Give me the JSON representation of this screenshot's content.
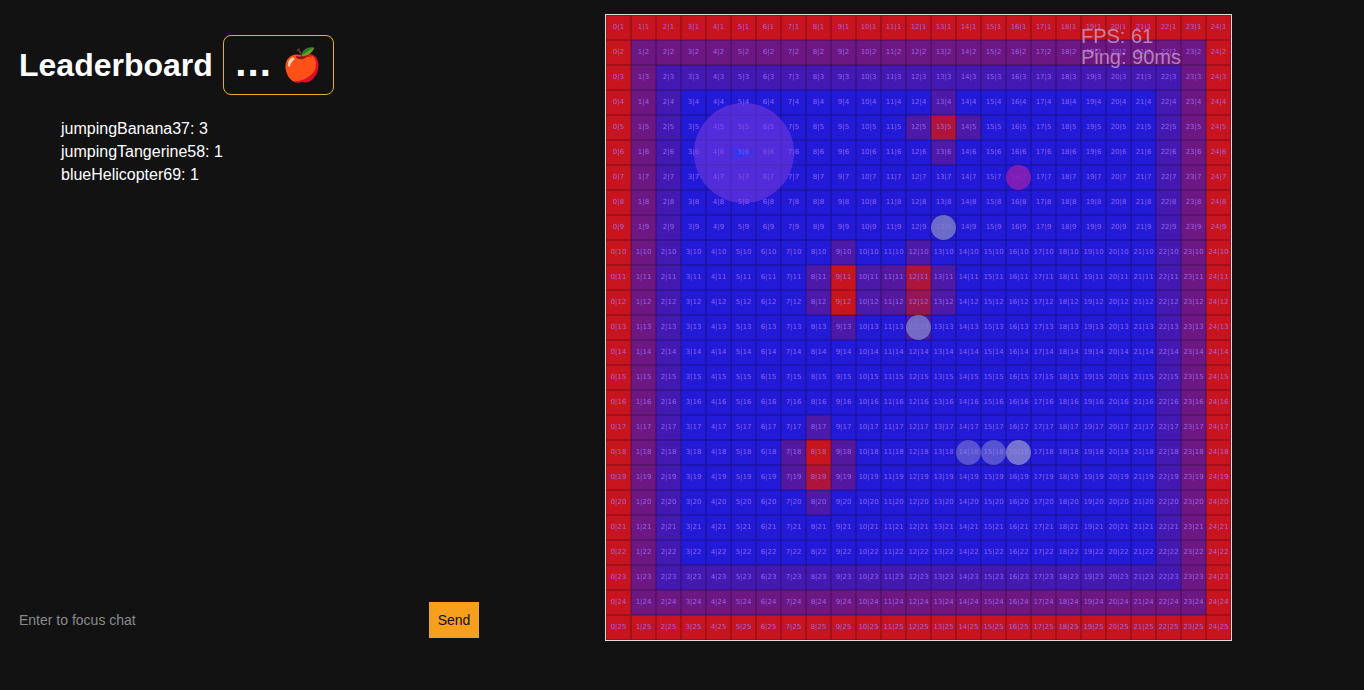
{
  "leaderboard": {
    "title": "Leaderboard",
    "badge": "... 🍎",
    "entries": [
      "jumpingBanana37: 3",
      "jumpingTangerine58: 1",
      "blueHelicopter69: 1"
    ]
  },
  "hud": {
    "fps": "FPS: 61",
    "ping": "Ping: 90ms"
  },
  "chat": {
    "placeholder": "Enter to focus chat",
    "button": "Send"
  },
  "arena": {
    "labels": [
      [
        "0|1",
        "1|1",
        "2|1",
        "3|1",
        "4|1",
        "5|1",
        "6|1",
        "7|1",
        "8|1",
        "9|1",
        "10|1",
        "11|1",
        "12|1",
        "13|1",
        "14|1",
        "15|1",
        "16|1",
        "17|1",
        "18|1",
        "19|1",
        "20|1",
        "21|1",
        "22|1",
        "23|1",
        "24|1"
      ],
      [
        "0|2",
        "1|2",
        "2|2",
        "3|2",
        "4|2",
        "5|2",
        "6|2",
        "7|2",
        "8|2",
        "9|2",
        "10|2",
        "11|2",
        "12|2",
        "13|2",
        "14|2",
        "15|2",
        "16|2",
        "17|2",
        "18|2",
        "19|2",
        "20|2",
        "21|2",
        "22|2",
        "23|2",
        "24|2"
      ],
      [
        "0|3",
        "1|3",
        "2|3",
        "3|3",
        "4|3",
        "5|3",
        "6|3",
        "7|3",
        "8|3",
        "9|3",
        "10|3",
        "11|3",
        "12|3",
        "13|3",
        "14|3",
        "15|3",
        "16|3",
        "17|3",
        "18|3",
        "19|3",
        "20|3",
        "21|3",
        "22|3",
        "23|3",
        "24|3"
      ],
      [
        "0|4",
        "1|4",
        "2|4",
        "3|4",
        "4|4",
        "5|4",
        "6|4",
        "7|4",
        "8|4",
        "9|4",
        "10|4",
        "11|4",
        "12|4",
        "13|4",
        "14|4",
        "15|4",
        "16|4",
        "17|4",
        "18|4",
        "19|4",
        "20|4",
        "21|4",
        "22|4",
        "23|4",
        "24|4"
      ],
      [
        "0|5",
        "1|5",
        "2|5",
        "3|5",
        "4|5",
        "5|5",
        "6|5",
        "7|5",
        "8|5",
        "9|5",
        "10|5",
        "11|5",
        "12|5",
        "13|5",
        "14|5",
        "15|5",
        "16|5",
        "17|5",
        "18|5",
        "19|5",
        "20|5",
        "21|5",
        "22|5",
        "23|5",
        "24|5"
      ],
      [
        "0|6",
        "1|6",
        "2|6",
        "3|6",
        "4|6",
        "5|6",
        "6|6",
        "7|6",
        "8|6",
        "9|6",
        "10|6",
        "11|6",
        "12|6",
        "13|6",
        "14|6",
        "15|6",
        "16|6",
        "17|6",
        "18|6",
        "19|6",
        "20|6",
        "21|6",
        "22|6",
        "23|6",
        "24|6"
      ],
      [
        "0|7",
        "1|7",
        "2|7",
        "3|7",
        "4|7",
        "5|7",
        "6|7",
        "7|7",
        "8|7",
        "9|7",
        "10|7",
        "11|7",
        "12|7",
        "13|7",
        "14|7",
        "15|7",
        "16|7",
        "17|7",
        "18|7",
        "19|7",
        "20|7",
        "21|7",
        "22|7",
        "23|7",
        "24|7"
      ],
      [
        "0|8",
        "1|8",
        "2|8",
        "3|8",
        "4|8",
        "5|8",
        "6|8",
        "7|8",
        "8|8",
        "9|8",
        "10|8",
        "11|8",
        "12|8",
        "13|8",
        "14|8",
        "15|8",
        "16|8",
        "17|8",
        "18|8",
        "19|8",
        "20|8",
        "21|8",
        "22|8",
        "23|8",
        "24|8"
      ],
      [
        "0|9",
        "1|9",
        "2|9",
        "3|9",
        "4|9",
        "5|9",
        "6|9",
        "7|9",
        "8|9",
        "9|9",
        "10|9",
        "11|9",
        "12|9",
        "13|9",
        "14|9",
        "15|9",
        "16|9",
        "17|9",
        "18|9",
        "19|9",
        "20|9",
        "21|9",
        "22|9",
        "23|9",
        "24|9"
      ],
      [
        "0|10",
        "1|10",
        "2|10",
        "3|10",
        "4|10",
        "5|10",
        "6|10",
        "7|10",
        "8|10",
        "9|10",
        "10|10",
        "11|10",
        "12|10",
        "13|10",
        "14|10",
        "15|10",
        "16|10",
        "17|10",
        "18|10",
        "19|10",
        "20|10",
        "21|10",
        "22|10",
        "23|10",
        "24|10"
      ],
      [
        "0|11",
        "1|11",
        "2|11",
        "3|11",
        "4|11",
        "5|11",
        "6|11",
        "7|11",
        "8|11",
        "9|11",
        "10|11",
        "11|11",
        "12|11",
        "13|11",
        "14|11",
        "15|11",
        "16|11",
        "17|11",
        "18|11",
        "19|11",
        "20|11",
        "21|11",
        "22|11",
        "23|11",
        "24|11"
      ],
      [
        "0|12",
        "1|12",
        "2|12",
        "3|12",
        "4|12",
        "5|12",
        "6|12",
        "7|12",
        "8|12",
        "9|12",
        "10|12",
        "11|12",
        "12|12",
        "13|12",
        "14|12",
        "15|12",
        "16|12",
        "17|12",
        "18|12",
        "19|12",
        "20|12",
        "21|12",
        "22|12",
        "23|12",
        "24|12"
      ],
      [
        "0|13",
        "1|13",
        "2|13",
        "3|13",
        "4|13",
        "5|13",
        "6|13",
        "7|13",
        "8|13",
        "9|13",
        "10|13",
        "11|13",
        "12|13",
        "13|13",
        "14|13",
        "15|13",
        "16|13",
        "17|13",
        "18|13",
        "19|13",
        "20|13",
        "21|13",
        "22|13",
        "23|13",
        "24|13"
      ],
      [
        "0|14",
        "1|14",
        "2|14",
        "3|14",
        "4|14",
        "5|14",
        "6|14",
        "7|14",
        "8|14",
        "9|14",
        "10|14",
        "11|14",
        "12|14",
        "13|14",
        "14|14",
        "15|14",
        "16|14",
        "17|14",
        "18|14",
        "19|14",
        "20|14",
        "21|14",
        "22|14",
        "23|14",
        "24|14"
      ],
      [
        "0|15",
        "1|15",
        "2|15",
        "3|15",
        "4|15",
        "5|15",
        "6|15",
        "7|15",
        "8|15",
        "9|15",
        "10|15",
        "11|15",
        "12|15",
        "13|15",
        "14|15",
        "15|15",
        "16|15",
        "17|15",
        "18|15",
        "19|15",
        "20|15",
        "21|15",
        "22|15",
        "23|15",
        "24|15"
      ],
      [
        "0|16",
        "1|16",
        "2|16",
        "3|16",
        "4|16",
        "5|16",
        "6|16",
        "7|16",
        "8|16",
        "9|16",
        "10|16",
        "11|16",
        "12|16",
        "13|16",
        "14|16",
        "15|16",
        "16|16",
        "17|16",
        "18|16",
        "19|16",
        "20|16",
        "21|16",
        "22|16",
        "23|16",
        "24|16"
      ],
      [
        "0|17",
        "1|17",
        "2|17",
        "3|17",
        "4|17",
        "5|17",
        "6|17",
        "7|17",
        "8|17",
        "9|17",
        "10|17",
        "11|17",
        "12|17",
        "13|17",
        "14|17",
        "15|17",
        "16|17",
        "17|17",
        "18|17",
        "19|17",
        "20|17",
        "21|17",
        "22|17",
        "23|17",
        "24|17"
      ],
      [
        "0|18",
        "1|18",
        "2|18",
        "3|18",
        "4|18",
        "5|18",
        "6|18",
        "7|18",
        "8|18",
        "9|18",
        "10|18",
        "11|18",
        "12|18",
        "13|18",
        "14|18",
        "15|18",
        "16|18",
        "17|18",
        "18|18",
        "19|18",
        "20|18",
        "21|18",
        "22|18",
        "23|18",
        "24|18"
      ],
      [
        "0|19",
        "1|19",
        "2|19",
        "3|19",
        "4|19",
        "5|19",
        "6|19",
        "7|19",
        "8|19",
        "9|19",
        "10|19",
        "11|19",
        "12|19",
        "13|19",
        "14|19",
        "15|19",
        "16|19",
        "17|19",
        "18|19",
        "19|19",
        "20|19",
        "21|19",
        "22|19",
        "23|19",
        "24|19"
      ],
      [
        "0|20",
        "1|20",
        "2|20",
        "3|20",
        "4|20",
        "5|20",
        "6|20",
        "7|20",
        "8|20",
        "9|20",
        "10|20",
        "11|20",
        "12|20",
        "13|20",
        "14|20",
        "15|20",
        "16|20",
        "17|20",
        "18|20",
        "19|20",
        "20|20",
        "21|20",
        "22|20",
        "23|20",
        "24|20"
      ],
      [
        "0|21",
        "1|21",
        "2|21",
        "3|21",
        "4|21",
        "5|21",
        "6|21",
        "7|21",
        "8|21",
        "9|21",
        "10|21",
        "11|21",
        "12|21",
        "13|21",
        "14|21",
        "15|21",
        "16|21",
        "17|21",
        "18|21",
        "19|21",
        "20|21",
        "21|21",
        "22|21",
        "23|21",
        "24|21"
      ],
      [
        "0|22",
        "1|22",
        "2|22",
        "3|22",
        "4|22",
        "5|22",
        "6|22",
        "7|22",
        "8|22",
        "9|22",
        "10|22",
        "11|22",
        "12|22",
        "13|22",
        "14|22",
        "15|22",
        "16|22",
        "17|22",
        "18|22",
        "19|22",
        "20|22",
        "21|22",
        "22|22",
        "23|22",
        "24|22"
      ],
      [
        "0|23",
        "1|23",
        "2|23",
        "3|23",
        "4|23",
        "5|23",
        "6|23",
        "7|23",
        "8|23",
        "9|23",
        "10|23",
        "11|23",
        "12|23",
        "13|23",
        "14|23",
        "15|23",
        "16|23",
        "17|23",
        "18|23",
        "19|23",
        "20|23",
        "21|23",
        "22|23",
        "23|23",
        "24|23"
      ],
      [
        "0|24",
        "1|24",
        "2|24",
        "3|24",
        "4|24",
        "5|24",
        "6|24",
        "7|24",
        "8|24",
        "9|24",
        "10|24",
        "11|24",
        "12|24",
        "13|24",
        "14|24",
        "15|24",
        "16|24",
        "17|24",
        "18|24",
        "19|24",
        "20|24",
        "21|24",
        "22|24",
        "23|24",
        "24|24"
      ],
      [
        "0|25",
        "1|25",
        "2|25",
        "3|25",
        "4|25",
        "5|25",
        "6|25",
        "7|25",
        "8|25",
        "9|25",
        "10|25",
        "11|25",
        "12|25",
        "13|25",
        "14|25",
        "15|25",
        "16|25",
        "17|25",
        "18|25",
        "19|25",
        "20|25",
        "21|25",
        "22|25",
        "23|25",
        "24|25"
      ]
    ],
    "heat": [
      [
        1,
        1,
        1,
        1,
        1,
        1,
        1,
        1,
        1,
        1,
        1,
        1,
        1,
        1,
        1,
        1,
        1,
        1,
        1,
        1,
        1,
        1,
        1,
        1,
        1
      ],
      [
        1,
        0.45,
        0.45,
        0.45,
        0.45,
        0.45,
        0.45,
        0.45,
        0.45,
        0.45,
        0.45,
        0.45,
        0.45,
        0.45,
        0.45,
        0.45,
        0.45,
        0.45,
        0.45,
        0.45,
        0.45,
        0.45,
        0.45,
        0.45,
        1
      ],
      [
        1,
        0.45,
        0.2,
        0.2,
        0.2,
        0.2,
        0.2,
        0.2,
        0.2,
        0.2,
        0.2,
        0.2,
        0.2,
        0.2,
        0.2,
        0.2,
        0.2,
        0.2,
        0.2,
        0.2,
        0.2,
        0.2,
        0.2,
        0.45,
        1
      ],
      [
        1,
        0.45,
        0.2,
        0,
        0,
        0,
        0,
        0,
        0,
        0,
        0,
        0,
        0,
        0.25,
        0,
        0,
        0,
        0,
        0,
        0,
        0,
        0,
        0.2,
        0.45,
        1
      ],
      [
        1,
        0.45,
        0.2,
        0,
        0,
        0,
        0,
        0,
        0,
        0,
        0,
        0,
        0.25,
        0.85,
        0.25,
        0,
        0,
        0,
        0,
        0,
        0,
        0,
        0.2,
        0.45,
        1
      ],
      [
        1,
        0.45,
        0.2,
        0,
        0,
        0,
        0,
        0,
        0,
        0,
        0,
        0,
        0,
        0.25,
        0,
        0,
        0,
        0,
        0,
        0,
        0,
        0,
        0.2,
        0.45,
        1
      ],
      [
        1,
        0.45,
        0.2,
        0,
        0,
        0,
        0,
        0,
        0,
        0,
        0,
        0,
        0,
        0,
        0,
        0,
        0,
        0,
        0,
        0,
        0,
        0,
        0.2,
        0.45,
        1
      ],
      [
        1,
        0.45,
        0.2,
        0,
        0,
        0,
        0,
        0,
        0,
        0,
        0,
        0,
        0,
        0,
        0,
        0,
        0,
        0,
        0,
        0,
        0,
        0,
        0.2,
        0.45,
        1
      ],
      [
        1,
        0.45,
        0.2,
        0,
        0,
        0,
        0,
        0,
        0,
        0,
        0,
        0,
        0,
        0,
        0,
        0,
        0,
        0,
        0,
        0,
        0,
        0,
        0.2,
        0.45,
        1
      ],
      [
        1,
        0.45,
        0.2,
        0,
        0,
        0,
        0,
        0,
        0,
        0.25,
        0,
        0,
        0.25,
        0,
        0,
        0,
        0,
        0,
        0,
        0,
        0,
        0,
        0.2,
        0.45,
        1
      ],
      [
        1,
        0.45,
        0.2,
        0,
        0,
        0,
        0,
        0,
        0.25,
        1,
        0.25,
        0.3,
        0.85,
        0.25,
        0,
        0,
        0,
        0,
        0,
        0,
        0,
        0,
        0.2,
        0.45,
        1
      ],
      [
        1,
        0.45,
        0.2,
        0,
        0,
        0,
        0,
        0,
        0.25,
        1,
        0.25,
        0.3,
        0.7,
        0.25,
        0,
        0,
        0,
        0,
        0,
        0,
        0,
        0,
        0.2,
        0.45,
        1
      ],
      [
        1,
        0.45,
        0.2,
        0,
        0,
        0,
        0,
        0,
        0,
        0.25,
        0,
        0,
        0.25,
        0,
        0,
        0,
        0,
        0,
        0,
        0,
        0,
        0,
        0.2,
        0.45,
        1
      ],
      [
        1,
        0.45,
        0.2,
        0,
        0,
        0,
        0,
        0,
        0,
        0,
        0,
        0,
        0,
        0,
        0,
        0,
        0,
        0,
        0,
        0,
        0,
        0,
        0.2,
        0.45,
        1
      ],
      [
        1,
        0.45,
        0.2,
        0,
        0,
        0,
        0,
        0,
        0,
        0,
        0,
        0,
        0,
        0,
        0,
        0,
        0,
        0,
        0,
        0,
        0,
        0,
        0.2,
        0.45,
        1
      ],
      [
        1,
        0.45,
        0.2,
        0,
        0,
        0,
        0,
        0,
        0,
        0,
        0,
        0,
        0,
        0,
        0,
        0,
        0,
        0,
        0,
        0,
        0,
        0,
        0.2,
        0.45,
        1
      ],
      [
        1,
        0.45,
        0.2,
        0,
        0,
        0,
        0,
        0,
        0.25,
        0,
        0,
        0,
        0,
        0,
        0,
        0,
        0,
        0,
        0,
        0,
        0,
        0,
        0.2,
        0.45,
        1
      ],
      [
        1,
        0.45,
        0.2,
        0,
        0,
        0,
        0,
        0.3,
        1,
        0.3,
        0,
        0,
        0,
        0,
        0,
        0,
        0,
        0,
        0,
        0,
        0,
        0,
        0.2,
        0.45,
        1
      ],
      [
        1,
        0.45,
        0.2,
        0,
        0,
        0,
        0,
        0.3,
        0.85,
        0.3,
        0,
        0,
        0,
        0,
        0,
        0,
        0,
        0,
        0,
        0,
        0,
        0,
        0.2,
        0.45,
        1
      ],
      [
        1,
        0.45,
        0.2,
        0,
        0,
        0,
        0,
        0,
        0.25,
        0,
        0,
        0,
        0,
        0,
        0,
        0,
        0,
        0,
        0,
        0,
        0,
        0,
        0.2,
        0.45,
        1
      ],
      [
        1,
        0.45,
        0.2,
        0,
        0,
        0,
        0,
        0,
        0,
        0,
        0,
        0,
        0,
        0,
        0,
        0,
        0,
        0,
        0,
        0,
        0,
        0,
        0.2,
        0.45,
        1
      ],
      [
        1,
        0.45,
        0.2,
        0,
        0,
        0,
        0,
        0,
        0,
        0,
        0,
        0,
        0,
        0,
        0,
        0,
        0,
        0,
        0,
        0,
        0,
        0,
        0.2,
        0.45,
        1
      ],
      [
        1,
        0.45,
        0.2,
        0.2,
        0.2,
        0.2,
        0.2,
        0.2,
        0.2,
        0.2,
        0.2,
        0.2,
        0.2,
        0.2,
        0.2,
        0.2,
        0.2,
        0.2,
        0.2,
        0.2,
        0.2,
        0.2,
        0.2,
        0.45,
        1
      ],
      [
        1,
        0.45,
        0.45,
        0.45,
        0.45,
        0.45,
        0.45,
        0.45,
        0.45,
        0.45,
        0.45,
        0.45,
        0.45,
        0.45,
        0.45,
        0.45,
        0.45,
        0.45,
        0.45,
        0.45,
        0.45,
        0.45,
        0.45,
        0.45,
        1
      ],
      [
        1,
        1,
        1,
        1,
        1,
        1,
        1,
        1,
        1,
        1,
        1,
        1,
        1,
        1,
        1,
        1,
        1,
        1,
        1,
        1,
        1,
        1,
        1,
        1,
        1
      ]
    ]
  },
  "players": [
    {
      "kind": "ship",
      "x": 5.5,
      "y": 5.5,
      "radius": 2,
      "color": "#7a3ce0"
    },
    {
      "kind": "blob",
      "x": 16.5,
      "y": 6.5,
      "radius": 0.5,
      "color": "#8b1fb0"
    },
    {
      "kind": "blob",
      "x": 13.5,
      "y": 8.5,
      "radius": 0.5,
      "color": "#7a7ac8"
    },
    {
      "kind": "blob",
      "x": 12.5,
      "y": 12.5,
      "radius": 0.5,
      "color": "#7a7ac8"
    },
    {
      "kind": "snake",
      "x": 16.5,
      "y": 17.5,
      "radius": 0.5,
      "color": "#8a8ad0",
      "body": [
        [
          14.5,
          17.5
        ],
        [
          15.5,
          17.5
        ]
      ]
    }
  ]
}
